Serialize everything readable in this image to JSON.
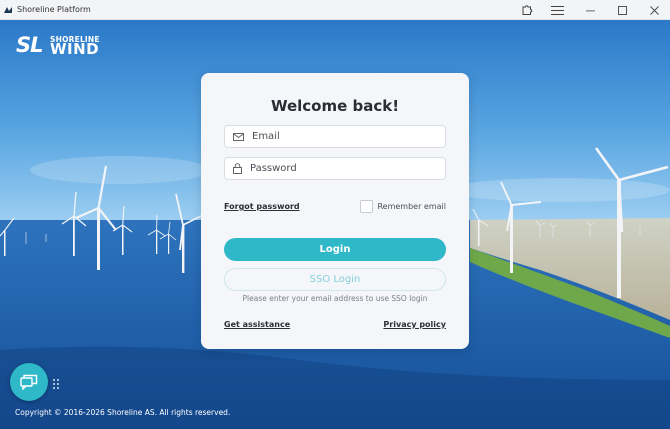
{
  "window": {
    "title": "Shoreline Platform"
  },
  "logo": {
    "mark": "SL",
    "line1": "SHORELINE",
    "line2": "WIND"
  },
  "login": {
    "title": "Welcome back!",
    "email_placeholder": "Email",
    "email_value": "",
    "password_placeholder": "Password",
    "password_value": "",
    "forgot_label": "Forgot password",
    "remember_label": "Remember email",
    "remember_checked": false,
    "login_label": "Login",
    "sso_label": "SSO Login",
    "sso_hint": "Please enter your email address to use SSO login",
    "assistance_label": "Get assistance",
    "privacy_label": "Privacy policy"
  },
  "footer": {
    "copyright": "Copyright © 2016-2026 Shoreline AS. All rights reserved."
  },
  "icons": {
    "app": "app-logo-icon",
    "extensions": "puzzle-icon",
    "menu": "hamburger-icon",
    "minimize": "minimize-icon",
    "maximize": "maximize-icon",
    "close": "close-icon",
    "email": "envelope-icon",
    "password": "lock-icon",
    "chat": "chat-bubbles-icon",
    "drag": "drag-handle-icon"
  },
  "colors": {
    "accent": "#2eb8c8",
    "sso_text": "#86d0da",
    "card_bg": "#f4f6fa",
    "sky": "#3e8fd6",
    "sea": "#1b5ea8"
  }
}
